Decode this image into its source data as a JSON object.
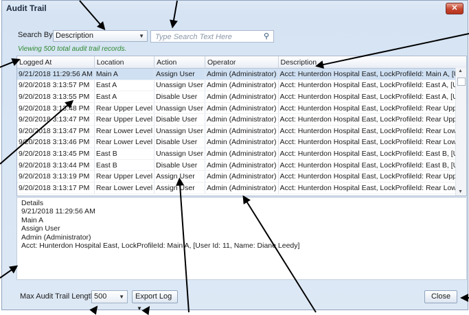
{
  "window": {
    "title": "Audit Trail",
    "close_glyph": "✕"
  },
  "search": {
    "label": "Search By:",
    "field_value": "Description",
    "placeholder": "Type Search Text Here"
  },
  "status": {
    "viewing_text": "Viewing 500 total audit trail records."
  },
  "grid": {
    "columns": [
      "Logged At",
      "Location",
      "Action",
      "Operator",
      "Description"
    ],
    "rows": [
      [
        "9/21/2018 11:29:56 AM",
        "Main A",
        "Assign User",
        "Admin (Administrator)",
        "Acct: Hunterdon Hospital East, LockProfileId: Main A, [User I"
      ],
      [
        "9/20/2018 3:13:57 PM",
        "East A",
        "Unassign User",
        "Admin (Administrator)",
        "Acct: Hunterdon Hospital East, LockProfileId: East A, [User Ic"
      ],
      [
        "9/20/2018 3:13:55 PM",
        "East A",
        "Disable User",
        "Admin (Administrator)",
        "Acct: Hunterdon Hospital East, LockProfileId: East A, [User Ic"
      ],
      [
        "9/20/2018 3:13:48 PM",
        "Rear Upper Level",
        "Unassign User",
        "Admin (Administrator)",
        "Acct: Hunterdon Hospital East, LockProfileId: Rear Upper Le"
      ],
      [
        "9/20/2018 3:13:47 PM",
        "Rear Upper Level",
        "Disable User",
        "Admin (Administrator)",
        "Acct: Hunterdon Hospital East, LockProfileId: Rear Upper Le"
      ],
      [
        "9/20/2018 3:13:47 PM",
        "Rear Lower Level",
        "Unassign User",
        "Admin (Administrator)",
        "Acct: Hunterdon Hospital East, LockProfileId: Rear Lower Lev"
      ],
      [
        "9/20/2018 3:13:46 PM",
        "Rear Lower Level",
        "Disable User",
        "Admin (Administrator)",
        "Acct: Hunterdon Hospital East, LockProfileId: Rear Lower Lev"
      ],
      [
        "9/20/2018 3:13:45 PM",
        "East B",
        "Unassign User",
        "Admin (Administrator)",
        "Acct: Hunterdon Hospital East, LockProfileId: East B, [User Ic"
      ],
      [
        "9/20/2018 3:13:44 PM",
        "East B",
        "Disable User",
        "Admin (Administrator)",
        "Acct: Hunterdon Hospital East, LockProfileId: East B, [User Ic"
      ],
      [
        "9/20/2018 3:13:19 PM",
        "Rear Upper Level",
        "Assign User",
        "Admin (Administrator)",
        "Acct: Hunterdon Hospital East, LockProfileId: Rear Upper Le"
      ],
      [
        "9/20/2018 3:13:17 PM",
        "Rear Lower Level",
        "Assign User",
        "Admin (Administrator)",
        "Acct: Hunterdon Hospital East, LockProfileId: Rear Lower Lev"
      ]
    ],
    "selected_row": 0
  },
  "details": {
    "heading": "Details",
    "lines": [
      "9/21/2018 11:29:56 AM",
      "Main A",
      "Assign User",
      "Admin (Administrator)",
      "Acct: Hunterdon Hospital East, LockProfileId: Main A, [User Id: 11, Name: Diane Leedy]"
    ]
  },
  "footer": {
    "max_length_label": "Max Audit Trail Length",
    "max_length_value": "500",
    "export_label": "Export Log",
    "close_label": "Close"
  },
  "icons": {
    "search": "search-icon",
    "dropdown": "chevron-down-icon",
    "close": "close-icon"
  }
}
